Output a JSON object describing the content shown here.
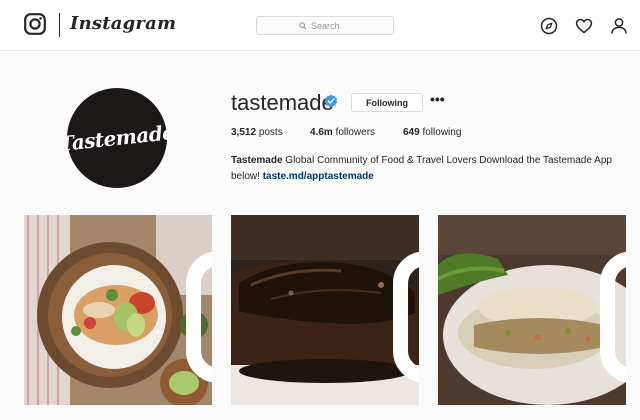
{
  "topbar": {
    "icon": "instagram-camera-icon",
    "wordmark": "Instagram",
    "search_placeholder": "Search",
    "nav_icons": [
      "compass-icon",
      "heart-icon",
      "person-icon"
    ]
  },
  "profile": {
    "avatar_text": "Tastemade",
    "username": "tastemade",
    "verified": true,
    "follow_label": "Following",
    "more_label": "•••",
    "stats": {
      "posts_count": "3,512",
      "posts_label": "posts",
      "followers_count": "4.6m",
      "followers_label": "followers",
      "following_count": "649",
      "following_label": "following"
    },
    "bio": {
      "name": "Tastemade",
      "text": "Global Community of Food & Travel Lovers Download the Tastemade App below!",
      "link": "taste.md/apptastemade"
    }
  },
  "posts": [
    {
      "type": "video",
      "depicts": "enchiladas-plate"
    },
    {
      "type": "video",
      "depicts": "chocolate-cake"
    },
    {
      "type": "video",
      "depicts": "stuffed-chicken"
    }
  ],
  "colors": {
    "accent_link": "#003569",
    "verified": "#3897f0",
    "border": "#dbdbdb",
    "background": "#fafafa"
  }
}
